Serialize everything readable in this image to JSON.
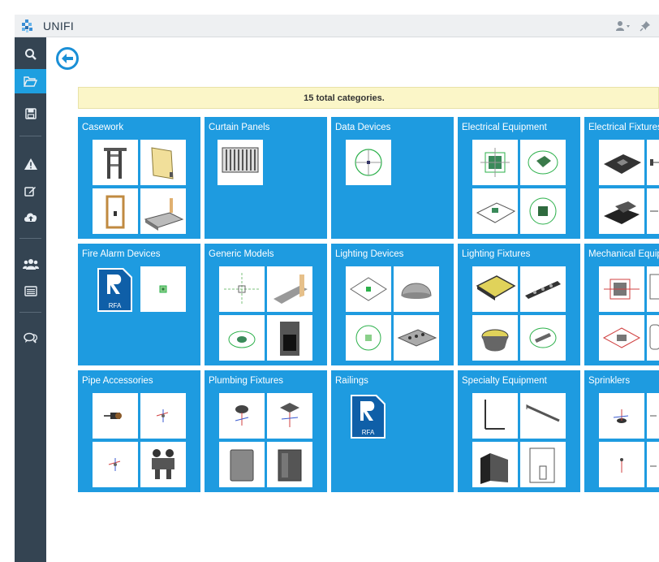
{
  "app": {
    "title": "UNIFI"
  },
  "banner": {
    "text": "15 total categories."
  },
  "toolbar": {
    "user_icon": "user-icon",
    "pin_icon": "pin-icon"
  },
  "sidebar": {
    "items": [
      {
        "icon": "search-icon",
        "active": false
      },
      {
        "icon": "folder-open-icon",
        "active": true
      },
      {
        "icon": "save-icon",
        "active": false
      },
      {
        "icon": "warning-icon",
        "active": false
      },
      {
        "icon": "edit-icon",
        "active": false
      },
      {
        "icon": "cloud-upload-icon",
        "active": false
      },
      {
        "icon": "users-icon",
        "active": false
      },
      {
        "icon": "list-icon",
        "active": false
      },
      {
        "icon": "chat-icon",
        "active": false
      }
    ]
  },
  "categories": [
    {
      "name": "Casework"
    },
    {
      "name": "Curtain Panels"
    },
    {
      "name": "Data Devices"
    },
    {
      "name": "Electrical Equipment"
    },
    {
      "name": "Electrical Fixtures"
    },
    {
      "name": "Fire Alarm Devices",
      "rfa_label": "RFA"
    },
    {
      "name": "Generic Models"
    },
    {
      "name": "Lighting Devices"
    },
    {
      "name": "Lighting Fixtures"
    },
    {
      "name": "Mechanical Equipment"
    },
    {
      "name": "Pipe Accessories"
    },
    {
      "name": "Plumbing Fixtures"
    },
    {
      "name": "Railings",
      "rfa_label": "RFA"
    },
    {
      "name": "Specialty Equipment"
    },
    {
      "name": "Sprinklers"
    }
  ],
  "colors": {
    "tile": "#1e9be0",
    "sidebar": "#344452",
    "active": "#1e9fe0",
    "banner": "#fbf6c8"
  }
}
